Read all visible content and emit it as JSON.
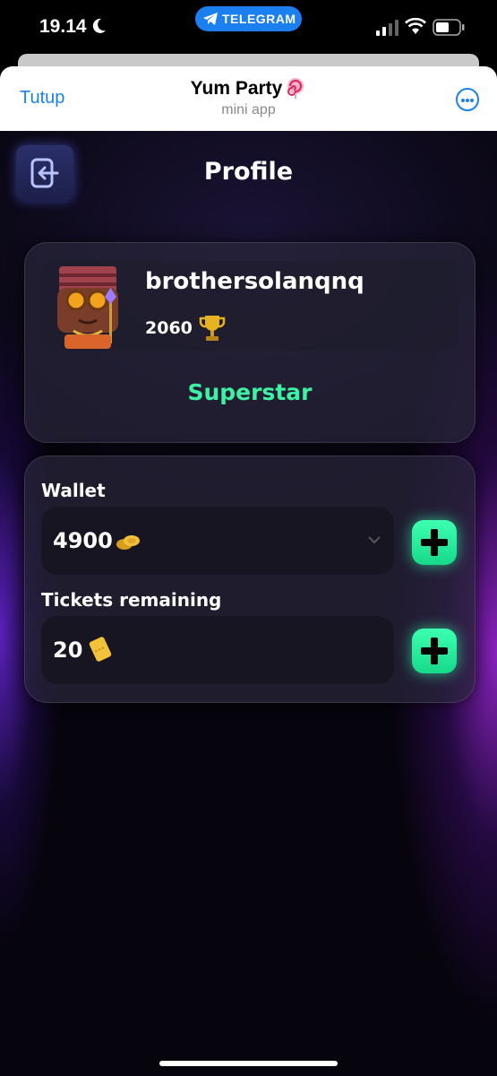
{
  "status_bar": {
    "time": "19.14",
    "source_app": "TELEGRAM"
  },
  "header": {
    "close_label": "Tutup",
    "title": "Yum Party",
    "subtitle": "mini app"
  },
  "page": {
    "title": "Profile"
  },
  "profile": {
    "username": "brothersolanqnq",
    "trophies": "2060",
    "rank": "Superstar"
  },
  "wallet": {
    "label": "Wallet",
    "amount": "4900"
  },
  "tickets": {
    "label": "Tickets remaining",
    "count": "20"
  },
  "colors": {
    "accent_green": "#3df2a3",
    "telegram_blue": "#1a82f0"
  }
}
